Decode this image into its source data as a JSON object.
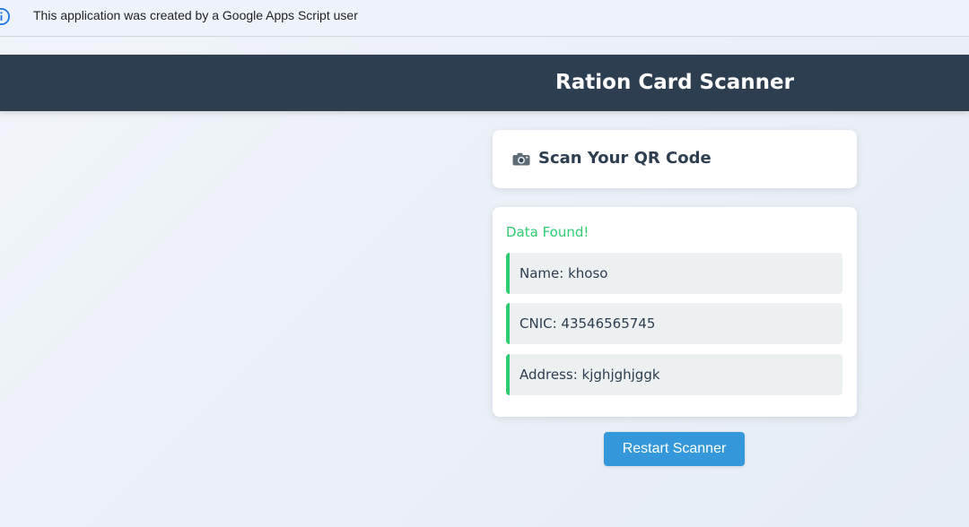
{
  "banner": {
    "icon": "info-icon",
    "text": "This application was created by a Google Apps Script user"
  },
  "header": {
    "title": "Ration Card Scanner"
  },
  "scan_card": {
    "icon": "camera-icon",
    "heading": "Scan Your QR Code"
  },
  "results": {
    "status": "Data Found!",
    "items": [
      {
        "text": "Name: khoso"
      },
      {
        "text": "CNIC: 43546565745"
      },
      {
        "text": "Address: kjghjghjggk"
      }
    ]
  },
  "actions": {
    "restart_label": "Restart Scanner"
  },
  "colors": {
    "header_bg": "#2c3e50",
    "success": "#2ecc71",
    "button_bg": "#3498db",
    "item_bg": "#ecf0f1"
  }
}
